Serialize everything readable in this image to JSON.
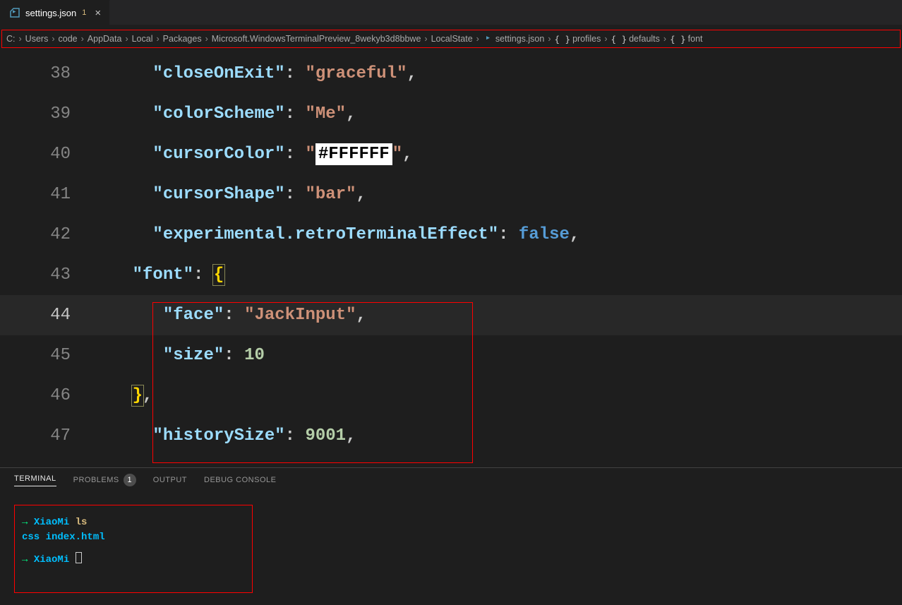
{
  "tab": {
    "filename": "settings.json",
    "modified_indicator": "1",
    "close": "×"
  },
  "breadcrumb": {
    "items": [
      "C:",
      "Users",
      "code",
      "AppData",
      "Local",
      "Packages",
      "Microsoft.WindowsTerminalPreview_8wekyb3d8bbwe",
      "LocalState"
    ],
    "file": "settings.json",
    "symbols": [
      "profiles",
      "defaults",
      "font"
    ]
  },
  "lines": {
    "l38": {
      "num": "38",
      "key": "\"closeOnExit\"",
      "val": "\"graceful\""
    },
    "l39": {
      "num": "39",
      "key": "\"colorScheme\"",
      "val": "\"Me\""
    },
    "l40": {
      "num": "40",
      "key": "\"cursorColor\"",
      "qopen": "\"",
      "swatch": "#FFFFFF",
      "qclose": "\""
    },
    "l41": {
      "num": "41",
      "key": "\"cursorShape\"",
      "val": "\"bar\""
    },
    "l42": {
      "num": "42",
      "key": "\"experimental.retroTerminalEffect\"",
      "val": "false"
    },
    "l43": {
      "num": "43",
      "key": "\"font\"",
      "brace": "{"
    },
    "l44": {
      "num": "44",
      "key": "\"face\"",
      "val": "\"JackInput\""
    },
    "l45": {
      "num": "45",
      "key": "\"size\"",
      "val": "10"
    },
    "l46": {
      "num": "46",
      "brace": "}"
    },
    "l47": {
      "num": "47",
      "key": "\"historySize\"",
      "val": "9001"
    }
  },
  "panel": {
    "tabs": {
      "terminal": "TERMINAL",
      "problems": "PROBLEMS",
      "problems_badge": "1",
      "output": "OUTPUT",
      "debug": "DEBUG CONSOLE"
    },
    "terminal": {
      "arrow": "→",
      "host": "XiaoMi",
      "cmd1": "ls",
      "out1": "css  index.html"
    }
  }
}
